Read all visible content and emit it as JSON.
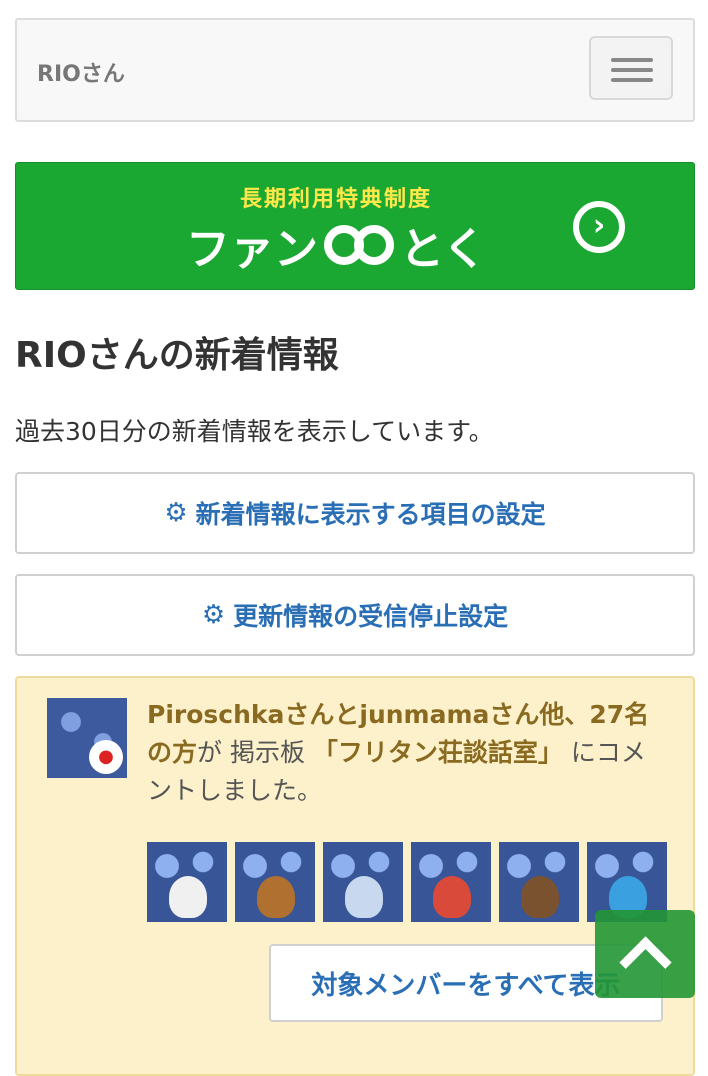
{
  "header": {
    "brand": "RIOさん"
  },
  "banner": {
    "subtitle": "長期利用特典制度",
    "title_part1": "ファン",
    "title_part2": "とく"
  },
  "page": {
    "title": "RIOさんの新着情報",
    "description": "過去30日分の新着情報を表示しています。"
  },
  "buttons": {
    "display_settings": "新着情報に表示する項目の設定",
    "unsubscribe_settings": "更新情報の受信停止設定",
    "show_all_members": "対象メンバーをすべて表示"
  },
  "activity": {
    "actors": "Piroschkaさんとjunmamaさん他、27名の方",
    "particle": "が 掲示板",
    "board": "「フリタン荘談話室」",
    "action": "にコメントしました。"
  },
  "icons": {
    "gear": "gear-icon",
    "scroll_top": "chevron-up-icon",
    "banner_arrow": "chevron-right-circle-icon"
  },
  "colors": {
    "banner_bg": "#1aa832",
    "link_blue": "#2a6fb5",
    "panel_bg": "#fcf1cb",
    "panel_text": "#8a6a20"
  }
}
